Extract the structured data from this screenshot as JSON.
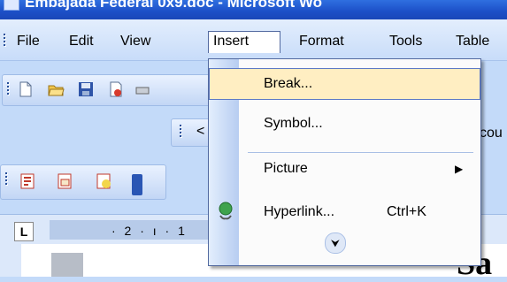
{
  "window": {
    "title": "Embajada Federal 0x9.doc - Microsoft Wo"
  },
  "menubar": {
    "items": [
      {
        "label": "File"
      },
      {
        "label": "Edit"
      },
      {
        "label": "View"
      },
      {
        "label": "Insert"
      },
      {
        "label": "Format"
      },
      {
        "label": "Tools"
      },
      {
        "label": "Table"
      }
    ]
  },
  "toolbar": {
    "formatting_partial": "<",
    "right_partial": "cou"
  },
  "ruler": {
    "marks": "· 2 · ı · 1",
    "tab_stop": "L"
  },
  "insert_menu": {
    "items": [
      {
        "label": "Break...",
        "highlighted": true
      },
      {
        "label": "Symbol..."
      },
      {
        "label": "Picture",
        "submenu_arrow": "▶"
      },
      {
        "label": "Hyperlink...",
        "shortcut": "Ctrl+K"
      }
    ],
    "expand_icon": "chevron-double-down"
  },
  "colors": {
    "highlight": "#ffeec2",
    "menubar": "#c8dcf9",
    "titlebar": "#1c4fc7"
  }
}
